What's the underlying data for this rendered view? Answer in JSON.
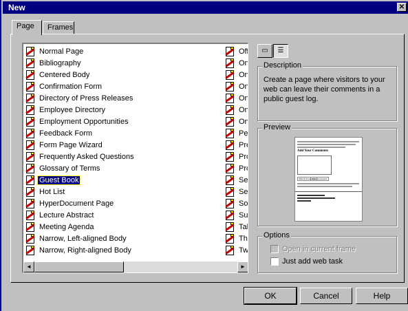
{
  "window": {
    "title": "New",
    "close_glyph": "✕"
  },
  "tabs": [
    {
      "label": "Page"
    },
    {
      "label": "Frames"
    }
  ],
  "list": {
    "items": [
      "Normal Page",
      "Bibliography",
      "Centered Body",
      "Confirmation Form",
      "Directory of Press Releases",
      "Employee Directory",
      "Employment Opportunities",
      "Feedback Form",
      "Form Page Wizard",
      "Frequently Asked Questions",
      "Glossary of Terms",
      "Guest Book",
      "Hot List",
      "HyperDocument Page",
      "Lecture Abstract",
      "Meeting Agenda",
      "Narrow, Left-aligned Body",
      "Narrow, Right-aligned Body"
    ],
    "selected_index": 11,
    "second_column": [
      "Offi",
      "One",
      "One",
      "One",
      "One",
      "One",
      "One",
      "Per",
      "Pre",
      "Pro",
      "Pro",
      "Sea",
      "Ser",
      "Sof",
      "Sur",
      "Tab",
      "Thr",
      "Two"
    ],
    "scroll_left": "◄",
    "scroll_right": "►"
  },
  "view_buttons": {
    "large_icons_glyph": "▭",
    "list_glyph": "☰"
  },
  "description": {
    "label": "Description",
    "text": "Create a page where visitors to your web can leave their comments in a public guest log."
  },
  "preview": {
    "label": "Preview",
    "heading": "Add Your Comments",
    "btn1": "Submit Comments",
    "btn2": "Clear Comments"
  },
  "options": {
    "label": "Options",
    "open_in_frame": "Open in current frame",
    "just_add_task": "Just add web task"
  },
  "buttons": {
    "ok": "OK",
    "cancel": "Cancel",
    "help": "Help"
  }
}
